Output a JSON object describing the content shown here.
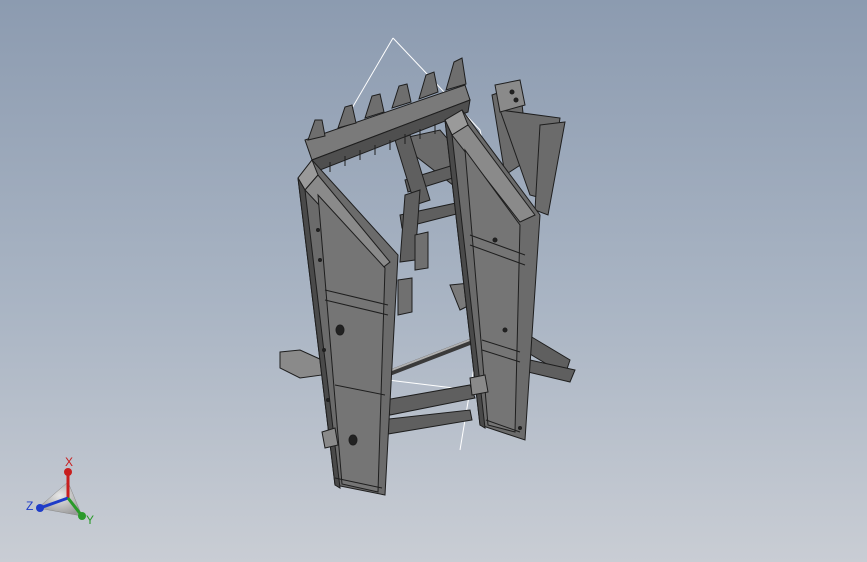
{
  "viewport": {
    "background_top": "#8c9bb0",
    "background_bottom": "#c9cdd4"
  },
  "model": {
    "frame_fill": "#6b6b6b",
    "frame_dark": "#3a3a3a",
    "frame_light": "#9a9a9a",
    "edge_color": "#1e1e1e",
    "construction_line_color": "#ffffff"
  },
  "triad": {
    "x_label": "X",
    "y_label": "Y",
    "z_label": "Z",
    "x_color": "#c81e1e",
    "y_color": "#2a9a2a",
    "z_color": "#1e3cc8"
  }
}
